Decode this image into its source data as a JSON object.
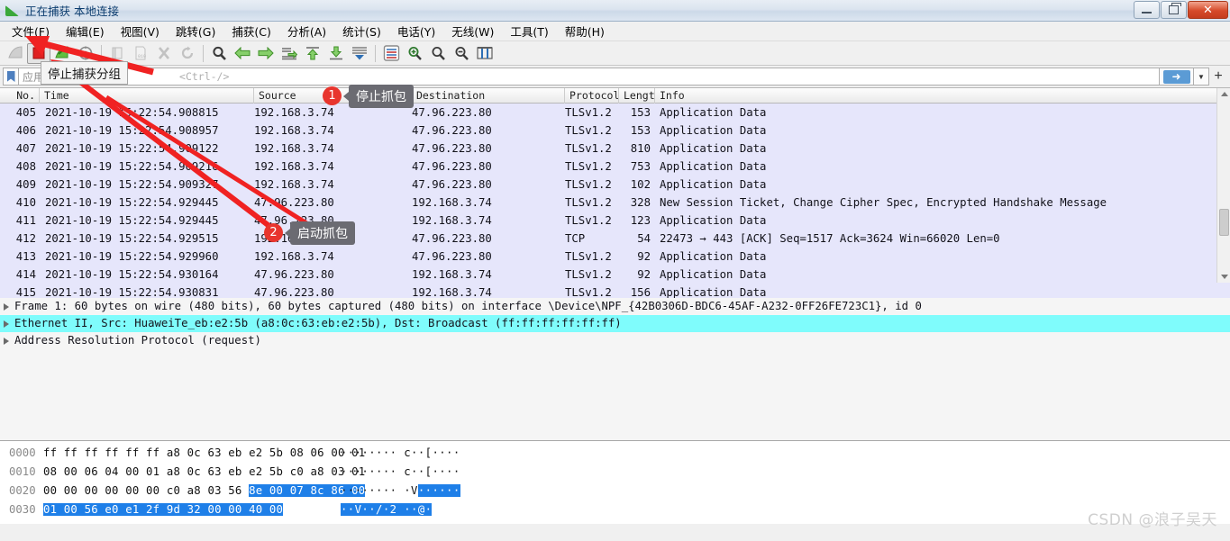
{
  "window": {
    "title": "正在捕获 本地连接",
    "icon": "wireshark-fin-icon",
    "minimize_label": "",
    "restore_label": "",
    "close_label": "✕"
  },
  "menubar": {
    "items": [
      {
        "label": "文件(F)",
        "name": "menu-file"
      },
      {
        "label": "编辑(E)",
        "name": "menu-edit"
      },
      {
        "label": "视图(V)",
        "name": "menu-view"
      },
      {
        "label": "跳转(G)",
        "name": "menu-goto"
      },
      {
        "label": "捕获(C)",
        "name": "menu-capture"
      },
      {
        "label": "分析(A)",
        "name": "menu-analyze"
      },
      {
        "label": "统计(S)",
        "name": "menu-statistics"
      },
      {
        "label": "电话(Y)",
        "name": "menu-telephony"
      },
      {
        "label": "无线(W)",
        "name": "menu-wireless"
      },
      {
        "label": "工具(T)",
        "name": "menu-tools"
      },
      {
        "label": "帮助(H)",
        "name": "menu-help"
      }
    ]
  },
  "toolbar": {
    "tooltip": "停止捕获分组",
    "buttons": [
      {
        "name": "start-capture-button",
        "icon": "shark-fin-icon",
        "enabled": false
      },
      {
        "name": "stop-capture-button",
        "icon": "stop-square-icon",
        "enabled": true
      },
      {
        "name": "restart-capture-button",
        "icon": "restart-arrow-icon",
        "enabled": true
      },
      {
        "name": "capture-options-button",
        "icon": "gear-target-icon",
        "enabled": true
      },
      {
        "name": "open-file-button",
        "icon": "folder-icon",
        "enabled": false
      },
      {
        "name": "save-file-button",
        "icon": "save-disk-icon",
        "enabled": false
      },
      {
        "name": "close-file-button",
        "icon": "close-x-icon",
        "enabled": false
      },
      {
        "name": "reload-button",
        "icon": "reload-icon",
        "enabled": false
      },
      {
        "name": "find-packet-button",
        "icon": "magnifier-icon",
        "enabled": true
      },
      {
        "name": "go-back-button",
        "icon": "arrow-left-icon",
        "enabled": true
      },
      {
        "name": "go-forward-button",
        "icon": "arrow-right-icon",
        "enabled": true
      },
      {
        "name": "go-to-packet-button",
        "icon": "goto-packet-icon",
        "enabled": true
      },
      {
        "name": "go-first-button",
        "icon": "arrow-up-top-icon",
        "enabled": true
      },
      {
        "name": "go-last-button",
        "icon": "arrow-down-bottom-icon",
        "enabled": true
      },
      {
        "name": "auto-scroll-button",
        "icon": "autoscroll-icon",
        "enabled": true
      },
      {
        "name": "colorize-button",
        "icon": "colorize-icon",
        "enabled": true
      },
      {
        "name": "zoom-in-button",
        "icon": "zoom-in-icon",
        "enabled": true
      },
      {
        "name": "zoom-out-button",
        "icon": "zoom-out-icon",
        "enabled": true
      },
      {
        "name": "zoom-reset-button",
        "icon": "zoom-reset-icon",
        "enabled": true
      },
      {
        "name": "resize-columns-button",
        "icon": "resize-columns-icon",
        "enabled": true
      }
    ]
  },
  "filter_bar": {
    "bookmark_icon": "bookmark-icon",
    "placeholder_cn": "应用显示过滤器",
    "placeholder_key": "<Ctrl-/>",
    "value": "",
    "apply_icon": "arrow-right-icon",
    "dropdown_icon": "chevron-down-icon",
    "add_button_label": "+"
  },
  "packet_list": {
    "columns": [
      {
        "label": "No.",
        "name": "column-no"
      },
      {
        "label": "Time",
        "name": "column-time"
      },
      {
        "label": "Source",
        "name": "column-source"
      },
      {
        "label": "Destination",
        "name": "column-destination"
      },
      {
        "label": "Protocol",
        "name": "column-protocol"
      },
      {
        "label": "Length",
        "name": "column-length"
      },
      {
        "label": "Info",
        "name": "column-info"
      }
    ],
    "rows": [
      {
        "no": "405",
        "time": "2021-10-19 15:22:54.908815",
        "src": "192.168.3.74",
        "dst": "47.96.223.80",
        "proto": "TLSv1.2",
        "len": "153",
        "info": "Application Data"
      },
      {
        "no": "406",
        "time": "2021-10-19 15:22:54.908957",
        "src": "192.168.3.74",
        "dst": "47.96.223.80",
        "proto": "TLSv1.2",
        "len": "153",
        "info": "Application Data"
      },
      {
        "no": "407",
        "time": "2021-10-19 15:22:54.909122",
        "src": "192.168.3.74",
        "dst": "47.96.223.80",
        "proto": "TLSv1.2",
        "len": "810",
        "info": "Application Data"
      },
      {
        "no": "408",
        "time": "2021-10-19 15:22:54.909216",
        "src": "192.168.3.74",
        "dst": "47.96.223.80",
        "proto": "TLSv1.2",
        "len": "753",
        "info": "Application Data"
      },
      {
        "no": "409",
        "time": "2021-10-19 15:22:54.909327",
        "src": "192.168.3.74",
        "dst": "47.96.223.80",
        "proto": "TLSv1.2",
        "len": "102",
        "info": "Application Data"
      },
      {
        "no": "410",
        "time": "2021-10-19 15:22:54.929445",
        "src": "47.96.223.80",
        "dst": "192.168.3.74",
        "proto": "TLSv1.2",
        "len": "328",
        "info": "New Session Ticket, Change Cipher Spec, Encrypted Handshake Message"
      },
      {
        "no": "411",
        "time": "2021-10-19 15:22:54.929445",
        "src": "47.96.223.80",
        "dst": "192.168.3.74",
        "proto": "TLSv1.2",
        "len": "123",
        "info": "Application Data"
      },
      {
        "no": "412",
        "time": "2021-10-19 15:22:54.929515",
        "src": "192.168.3.74",
        "dst": "47.96.223.80",
        "proto": "TCP",
        "len": "54",
        "info": "22473 → 443 [ACK] Seq=1517 Ack=3624 Win=66020 Len=0"
      },
      {
        "no": "413",
        "time": "2021-10-19 15:22:54.929960",
        "src": "192.168.3.74",
        "dst": "47.96.223.80",
        "proto": "TLSv1.2",
        "len": "92",
        "info": "Application Data"
      },
      {
        "no": "414",
        "time": "2021-10-19 15:22:54.930164",
        "src": "47.96.223.80",
        "dst": "192.168.3.74",
        "proto": "TLSv1.2",
        "len": "92",
        "info": "Application Data"
      },
      {
        "no": "415",
        "time": "2021-10-19 15:22:54.930831",
        "src": "47.96.223.80",
        "dst": "192.168.3.74",
        "proto": "TLSv1.2",
        "len": "156",
        "info": "Application Data"
      }
    ]
  },
  "detail_pane": {
    "rows": [
      {
        "text": "Frame 1: 60 bytes on wire (480 bits), 60 bytes captured (480 bits) on interface \\Device\\NPF_{42B0306D-BDC6-45AF-A232-0FF26FE723C1}, id 0",
        "highlighted": false
      },
      {
        "text": "Ethernet II, Src: HuaweiTe_eb:e2:5b (a8:0c:63:eb:e2:5b), Dst: Broadcast (ff:ff:ff:ff:ff:ff)",
        "highlighted": true
      },
      {
        "text": "Address Resolution Protocol (request)",
        "highlighted": false
      }
    ]
  },
  "hex_pane": {
    "rows": [
      {
        "offset": "0000",
        "bytes_plain": "ff ff ff ff ff ff a8 0c  63 eb e2 5b 08 06 00 01",
        "bytes_sel": "",
        "ascii_plain": "········ c··[····",
        "ascii_sel": ""
      },
      {
        "offset": "0010",
        "bytes_plain": "08 00 06 04 00 01 a8 0c  63 eb e2 5b c0 a8 03 01",
        "bytes_sel": "",
        "ascii_plain": "········ c··[····",
        "ascii_sel": ""
      },
      {
        "offset": "0020",
        "bytes_plain": "00 00 00 00 00 00 c0 a8  03 56 ",
        "bytes_sel": "8e 00 07 8c 86 00",
        "ascii_plain": "········ ·V",
        "ascii_sel": "······"
      },
      {
        "offset": "0030",
        "bytes_plain": "",
        "bytes_sel": "01 00 56 e0 e1 2f 9d 32  00 00 40 00",
        "ascii_plain": "",
        "ascii_sel": "··V··/·2 ··@·"
      }
    ]
  },
  "annotations": [
    {
      "badge": "1",
      "label": "停止抓包",
      "name": "annotation-stop-capture"
    },
    {
      "badge": "2",
      "label": "启动抓包",
      "name": "annotation-start-capture"
    }
  ],
  "watermark": {
    "text": "CSDN @浪子吴天"
  },
  "colors": {
    "packet_row_bg": "#e6e6fb",
    "detail_highlight": "#7ffcfc",
    "hex_selection": "#1e7fe8",
    "annotation_red": "#e8352e",
    "annotation_tip_bg": "#6b6b72"
  }
}
